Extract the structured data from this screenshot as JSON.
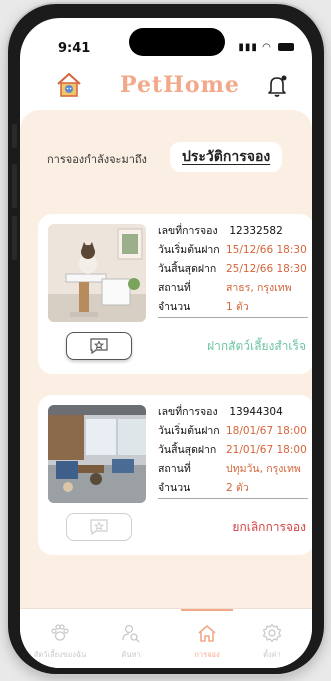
{
  "status_bar": {
    "time": "9:41"
  },
  "app": {
    "brand": "PetHome"
  },
  "tabs": {
    "upcoming": "การจองกำลังจะมาถึง",
    "history": "ประวัติการจอง"
  },
  "bookings": [
    {
      "booking_no_label": "เลขที่การจอง",
      "booking_no": "12332582",
      "start_label": "วันเริ่มต้นฝาก",
      "start": "15/12/66  18:30",
      "end_label": "วันสิ้นสุดฝาก",
      "end": "25/12/66 18:30",
      "location_label": "สถานที่",
      "location": "สาธร, กรุงเทพ",
      "count_label": "จำนวน",
      "count": "1 ตัว",
      "status": "ฝากสัตว์เลี้ยงสำเร็จ"
    },
    {
      "booking_no_label": "เลขที่การจอง",
      "booking_no": "13944304",
      "start_label": "วันเริ่มต้นฝาก",
      "start": "18/01/67 18:00",
      "end_label": "วันสิ้นสุดฝาก",
      "end": "21/01/67 18:00",
      "location_label": "สถานที่",
      "location": "ปทุมวัน, กรุงเทพ",
      "count_label": "จำนวน",
      "count": "2 ตัว",
      "status": "ยกเลิกการจอง"
    }
  ],
  "nav": [
    {
      "label": "สัตว์เลี้ยงของฉัน",
      "icon": "paw-icon"
    },
    {
      "label": "ค้นหา",
      "icon": "search-person-icon"
    },
    {
      "label": "การจอง",
      "icon": "home-icon"
    },
    {
      "label": "ตั้งค่า",
      "icon": "gear-icon"
    }
  ],
  "colors": {
    "brand": "#f2a98a",
    "background": "#fbeee2",
    "value_text": "#d4653b",
    "success": "#6cc4a1",
    "cancel": "#d43f3f"
  }
}
